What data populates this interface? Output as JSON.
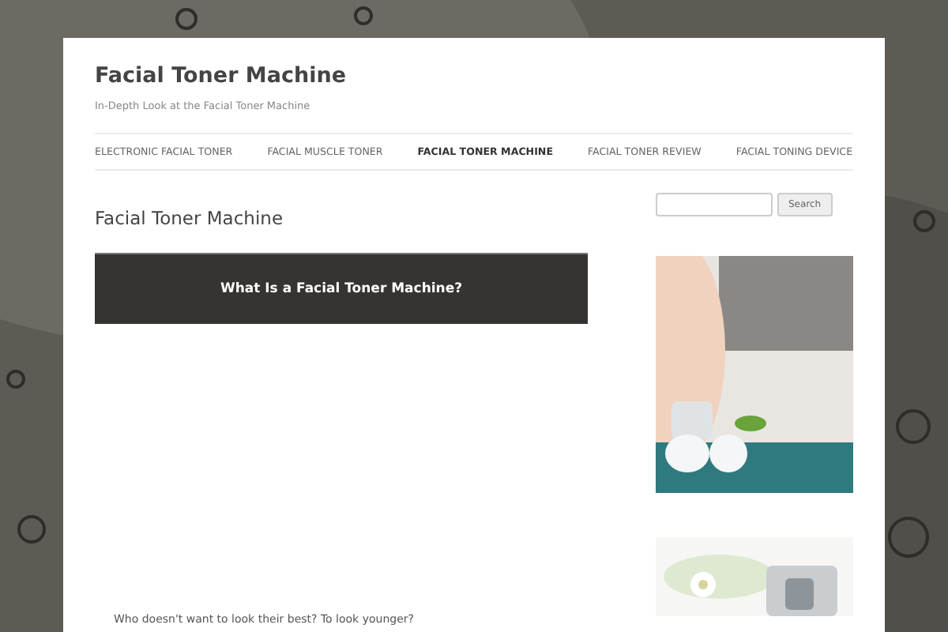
{
  "site": {
    "title": "Facial Toner Machine",
    "tagline": "In-Depth Look at the Facial Toner Machine"
  },
  "nav": [
    {
      "label": "ELECTRONIC FACIAL TONER",
      "selected": false
    },
    {
      "label": "FACIAL MUSCLE TONER",
      "selected": false
    },
    {
      "label": "FACIAL TONER MACHINE",
      "selected": true
    },
    {
      "label": "FACIAL TONER REVIEW",
      "selected": false
    },
    {
      "label": "FACIAL TONING DEVICE",
      "selected": false
    }
  ],
  "page": {
    "title": "Facial Toner Machine",
    "banner": "What Is a Facial Toner Machine?",
    "body": "Who doesn't want to look their best? To look younger?"
  },
  "sidebar": {
    "search": {
      "button": "Search"
    }
  }
}
